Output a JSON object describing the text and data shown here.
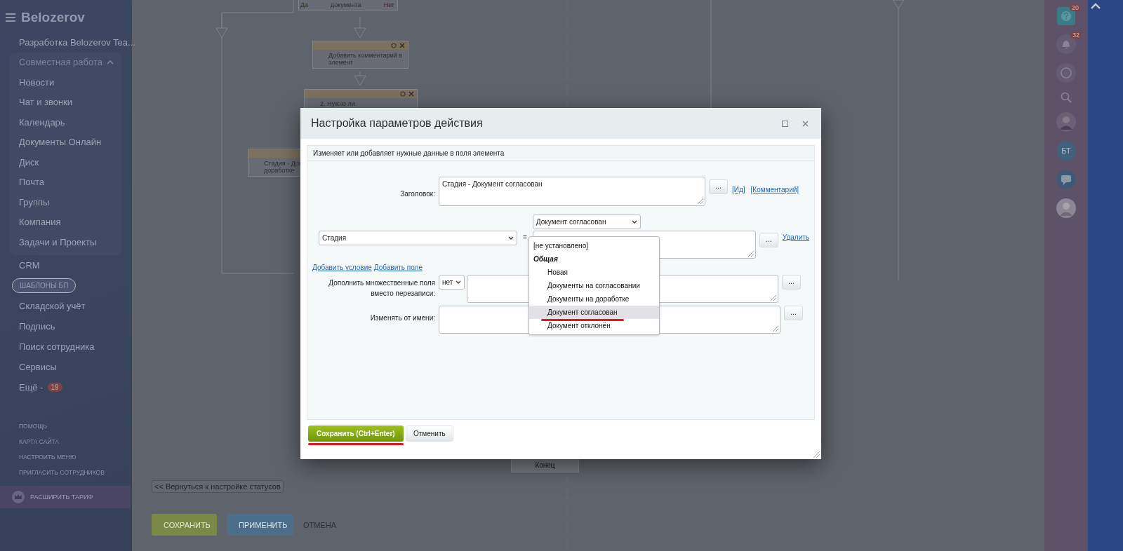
{
  "sidebar": {
    "brand": "Belozerov",
    "items": [
      {
        "kind": "item",
        "label": "Разработка Belozerov Tea...",
        "selected": false
      },
      {
        "kind": "group",
        "label": "Совместная работа",
        "expanded": true,
        "children": [
          {
            "label": "Новости",
            "selected": false
          },
          {
            "label": "Чат и звонки",
            "selected": false
          },
          {
            "label": "Календарь",
            "selected": false
          },
          {
            "label": "Документы Онлайн",
            "selected": false
          },
          {
            "label": "Диск",
            "selected": false
          },
          {
            "label": "Почта",
            "selected": false
          },
          {
            "label": "Группы",
            "selected": false
          },
          {
            "label": "Компания",
            "selected": false
          },
          {
            "label": "Задачи и Проекты",
            "selected": false
          }
        ]
      },
      {
        "kind": "item",
        "label": "CRM",
        "selected": false
      },
      {
        "kind": "item",
        "label": "ШАБЛОНЫ БП",
        "selected": true
      },
      {
        "kind": "item",
        "label": "Складской учёт",
        "selected": false
      },
      {
        "kind": "item",
        "label": "Подпись",
        "selected": false
      },
      {
        "kind": "item",
        "label": "Поиск сотрудника",
        "selected": false
      },
      {
        "kind": "item",
        "label": "Сервисы",
        "selected": false
      },
      {
        "kind": "item",
        "label": "Ещё -",
        "counter": "19",
        "selected": false
      }
    ],
    "footer_links": [
      "ПОМОЩЬ",
      "КАРТА САЙТА",
      "НАСТРОИТЬ МЕНЮ",
      "ПРИГЛАСИТЬ СОТРУДНИКОВ"
    ],
    "upgrade_button": "РАСШИРИТЬ ТАРИФ"
  },
  "diagram": {
    "nodes": [
      {
        "kind": "condition",
        "lines": [
          "документа"
        ],
        "yes": "Да",
        "no": "Нет"
      },
      {
        "kind": "action",
        "lines": [
          "Добавить комментарий в",
          "элемент"
        ]
      },
      {
        "kind": "action",
        "lines": [
          "2. Нужно ли"
        ]
      },
      {
        "kind": "action",
        "lines": [
          "Стадия - Док",
          "доработке"
        ]
      },
      {
        "kind": "end",
        "lines": [
          "Конец"
        ]
      }
    ]
  },
  "back_link": "<< Вернуться к настройке статусов",
  "page_buttons": [
    {
      "kind": "primary",
      "label": "СОХРАНИТЬ"
    },
    {
      "kind": "secondary",
      "label": "ПРИМЕНИТЬ"
    },
    {
      "kind": "link",
      "label": "ОТМЕНА"
    }
  ],
  "right_bar": {
    "help_counter": "20",
    "notifications_counter": "32",
    "user_initials": "БТ"
  },
  "modal": {
    "title": "Настройка параметров действия",
    "description": "Изменяет или добавляет нужные данные в поля элемента",
    "title_field": {
      "label": "Заголовок:",
      "value": "Стадия - Документ согласован",
      "more_button": "...",
      "links": [
        "[Ид]",
        "[Комментарий]"
      ]
    },
    "condition": {
      "field": "Стадия",
      "operator": "=",
      "value": "Документ согласован",
      "more_button": "...",
      "delete_link": "Удалить"
    },
    "add_links": [
      "Добавить условие",
      "Добавить поле"
    ],
    "merge_field": {
      "label": "Дополнить множественные поля вместо перезаписи:",
      "value": "нет",
      "more_button": "..."
    },
    "modify_by": {
      "label": "Изменять от имени:",
      "more_button": "..."
    },
    "dropdown": {
      "options": [
        {
          "kind": "option",
          "label": "[не установлено]",
          "selected": false,
          "underlined": false
        },
        {
          "kind": "group",
          "label": "Общая",
          "children": [
            {
              "label": "Новая",
              "selected": false,
              "underlined": false
            },
            {
              "label": "Документы на согласовании",
              "selected": false,
              "underlined": false
            },
            {
              "label": "Документы на доработке",
              "selected": false,
              "underlined": false
            },
            {
              "label": "Документ согласован",
              "selected": true,
              "underlined": true
            },
            {
              "label": "Документ отклонён",
              "selected": false,
              "underlined": false
            }
          ]
        }
      ]
    },
    "save_button": {
      "label": "Сохранить (Ctrl+Enter)",
      "underlined": true
    },
    "cancel_button": "Отменить"
  }
}
